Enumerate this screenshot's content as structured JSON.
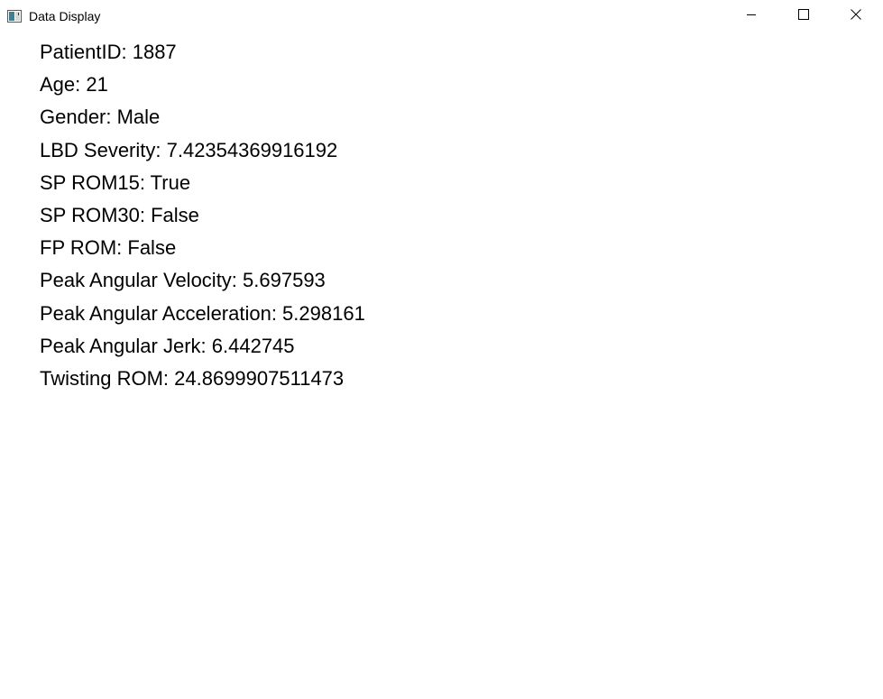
{
  "window": {
    "title": "Data Display",
    "icon": "app-window-icon",
    "controls": [
      "minimize-icon",
      "maximize-icon",
      "close-icon"
    ]
  },
  "fields": [
    "PatientID: 1887",
    "Age: 21",
    "Gender: Male",
    "LBD Severity: 7.42354369916192",
    "SP ROM15: True",
    "SP ROM30: False",
    "FP ROM: False",
    "Peak Angular Velocity: 5.697593",
    "Peak Angular Acceleration: 5.298161",
    "Peak Angular Jerk: 6.442745",
    "Twisting ROM: 24.8699907511473"
  ]
}
